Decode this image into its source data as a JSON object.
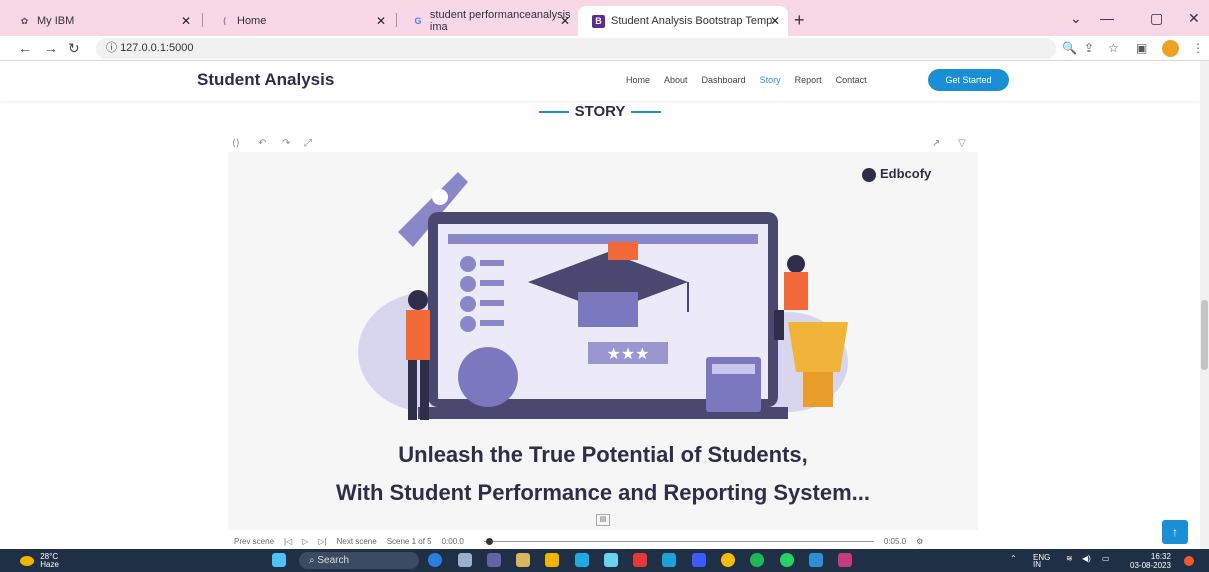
{
  "browser": {
    "tabs": [
      {
        "label": "My IBM",
        "active": false
      },
      {
        "label": "Home",
        "active": false
      },
      {
        "label": "student performanceanalysis ima",
        "active": false
      },
      {
        "label": "Student Analysis Bootstrap Temp",
        "active": true
      }
    ],
    "url": "127.0.0.1:5000"
  },
  "site": {
    "brand": "Student Analysis",
    "nav": [
      "Home",
      "About",
      "Dashboard",
      "Story",
      "Report",
      "Contact"
    ],
    "active_nav": "Story",
    "cta": "Get Started",
    "section_title": "STORY"
  },
  "story": {
    "logo": "Edbcofy",
    "caption_line1": "Unleash the True Potential of Students,",
    "caption_line2": "With Student Performance and Reporting System..."
  },
  "player": {
    "prev": "Prev scene",
    "next": "Next scene",
    "scene": "Scene 1 of 5",
    "time_start": "0:00.0",
    "time_end": "0:05.0"
  },
  "taskbar": {
    "temp": "28°C",
    "weather": "Haze",
    "search": "Search",
    "lang": "ENG",
    "region": "IN",
    "time": "16:32",
    "date": "03-08-2023"
  },
  "colors": {
    "accent": "#1b8fd6",
    "tabbar": "#f8d8e6",
    "taskbar": "#1f2f45"
  }
}
